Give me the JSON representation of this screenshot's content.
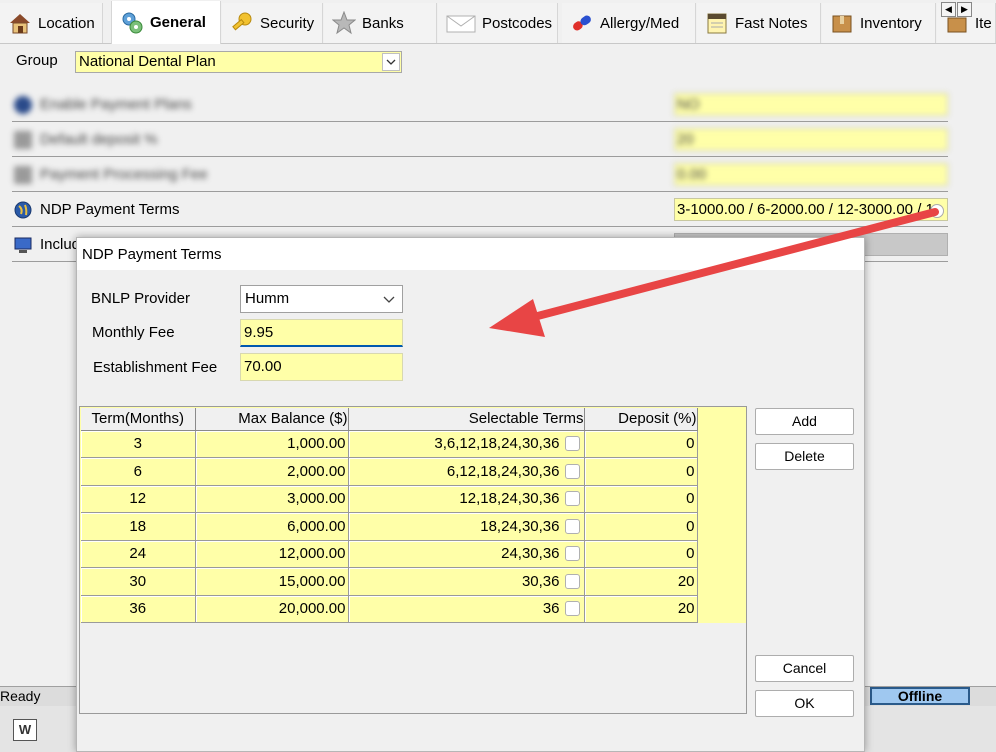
{
  "tabs": [
    {
      "label": "Location",
      "icon": "house-icon"
    },
    {
      "label": "General",
      "icon": "gears-icon",
      "active": true
    },
    {
      "label": "Security",
      "icon": "key-icon"
    },
    {
      "label": "Banks",
      "icon": "star-icon"
    },
    {
      "label": "Postcodes",
      "icon": "envelope-icon"
    },
    {
      "label": "Allergy/Med",
      "icon": "capsule-icon"
    },
    {
      "label": "Fast Notes",
      "icon": "notepad-icon"
    },
    {
      "label": "Inventory",
      "icon": "box-icon"
    },
    {
      "label": "Ite",
      "icon": "box-icon"
    }
  ],
  "group": {
    "label": "Group",
    "value": "National Dental Plan"
  },
  "settings": [
    {
      "label": "Enable Payment Plans",
      "value": "NO",
      "blurred": true
    },
    {
      "label": "Default deposit %",
      "value": "20",
      "blurred": true
    },
    {
      "label": "Payment Processing Fee",
      "value": "0.00",
      "blurred": true
    },
    {
      "label": "NDP Payment Terms",
      "value": "3-1000.00 / 6-2000.00 / 12-3000.00 / 1",
      "blurred": false
    },
    {
      "label": "Includ",
      "value": "",
      "blurred": false
    }
  ],
  "status": {
    "ready": "Ready",
    "offline": "Offline"
  },
  "dialog": {
    "title": "NDP Payment Terms",
    "provider": {
      "label": "BNLP Provider",
      "value": "Humm"
    },
    "monthly_fee": {
      "label": "Monthly Fee",
      "value": "9.95"
    },
    "establishment_fee": {
      "label": "Establishment Fee",
      "value": "70.00"
    },
    "columns": [
      "Term(Months)",
      "Max Balance ($)",
      "Selectable Terms",
      "Deposit (%)"
    ],
    "rows": [
      {
        "term": "3",
        "max_balance": "1,000.00",
        "selectable": "3,6,12,18,24,30,36",
        "deposit": "0"
      },
      {
        "term": "6",
        "max_balance": "2,000.00",
        "selectable": "6,12,18,24,30,36",
        "deposit": "0"
      },
      {
        "term": "12",
        "max_balance": "3,000.00",
        "selectable": "12,18,24,30,36",
        "deposit": "0"
      },
      {
        "term": "18",
        "max_balance": "6,000.00",
        "selectable": "18,24,30,36",
        "deposit": "0"
      },
      {
        "term": "24",
        "max_balance": "12,000.00",
        "selectable": "24,30,36",
        "deposit": "0"
      },
      {
        "term": "30",
        "max_balance": "15,000.00",
        "selectable": "30,36",
        "deposit": "20"
      },
      {
        "term": "36",
        "max_balance": "20,000.00",
        "selectable": "36",
        "deposit": "20"
      }
    ],
    "buttons": {
      "add": "Add",
      "delete": "Delete",
      "cancel": "Cancel",
      "ok": "OK"
    }
  },
  "colors": {
    "field_yellow": "#ffffa8",
    "arrow_red": "#e84545",
    "offline_bg": "#9fc8f0"
  },
  "status_word_icon": "W"
}
